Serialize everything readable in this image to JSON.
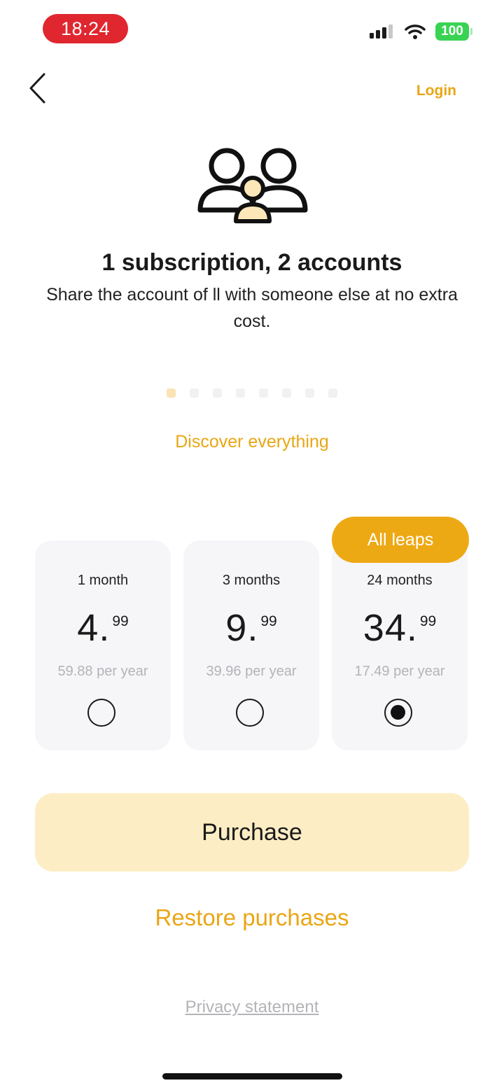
{
  "status_bar": {
    "time": "18:24",
    "battery": "100",
    "icons": [
      "cellular-signal-icon",
      "wifi-icon",
      "battery-icon"
    ]
  },
  "header": {
    "back_icon": "chevron-left-icon",
    "login_label": "Login"
  },
  "hero": {
    "icon": "users-group-icon",
    "title": "1 subscription, 2 accounts",
    "subtitle": "Share the account of ll with someone else at no extra cost."
  },
  "pager": {
    "count": 8,
    "active_index": 0
  },
  "discover_label": "Discover everything",
  "plans": [
    {
      "duration": "1 month",
      "price_whole": "4.",
      "price_cents": "99",
      "per_year": "59.88 per year",
      "selected": false
    },
    {
      "duration": "3 months",
      "price_whole": "9.",
      "price_cents": "99",
      "per_year": "39.96 per year",
      "selected": false
    },
    {
      "duration": "24 months",
      "price_whole": "34.",
      "price_cents": "99",
      "per_year": "17.49 per year",
      "selected": true,
      "badge": "All leaps"
    }
  ],
  "purchase_label": "Purchase",
  "restore_label": "Restore purchases",
  "privacy_label": "Privacy statement",
  "colors": {
    "accent": "#e9a614",
    "badge": "#eda914",
    "purchase_bg": "#fdedc4",
    "card_bg": "#f6f5f8",
    "time_pill": "#e0262f",
    "battery": "#39d353"
  }
}
